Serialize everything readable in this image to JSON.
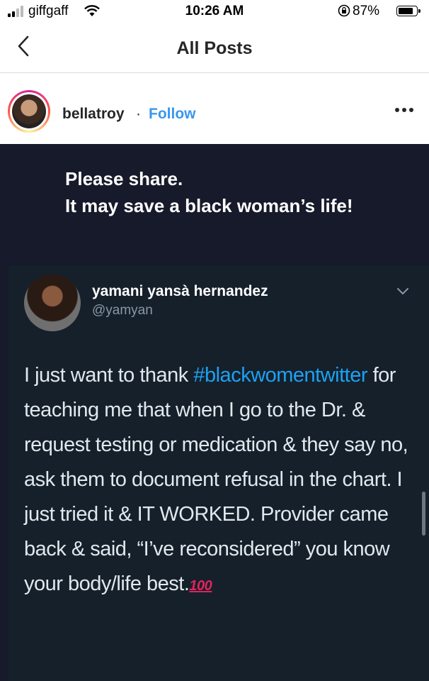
{
  "status_bar": {
    "carrier": "giffgaff",
    "time": "10:26 AM",
    "battery_percent": "87%",
    "battery_level": 0.87
  },
  "nav": {
    "title": "All Posts"
  },
  "post_header": {
    "username": "bellatroy",
    "separator": "·",
    "follow_label": "Follow"
  },
  "post": {
    "caption_line1": "Please share.",
    "caption_line2": "It may save a black woman’s life!",
    "tweet": {
      "display_name": "yamani yansà hernandez",
      "handle": "@yamyan",
      "text_before": "I just want to thank ",
      "hashtag": "#blackwomentwitter",
      "text_after": " for teaching me that when I go to the Dr. & request testing or medication & they say no, ask them to document refusal in the chart. I just tried it & IT WORKED. Provider came back & said, “I’ve reconsidered” you know your body/life best.",
      "emoji": "100"
    }
  },
  "colors": {
    "follow_blue": "#3897f0",
    "post_background": "#161a2a",
    "tweet_background": "#15202b",
    "hashtag_blue": "#1da1f2",
    "emoji_red": "#e0245e"
  }
}
